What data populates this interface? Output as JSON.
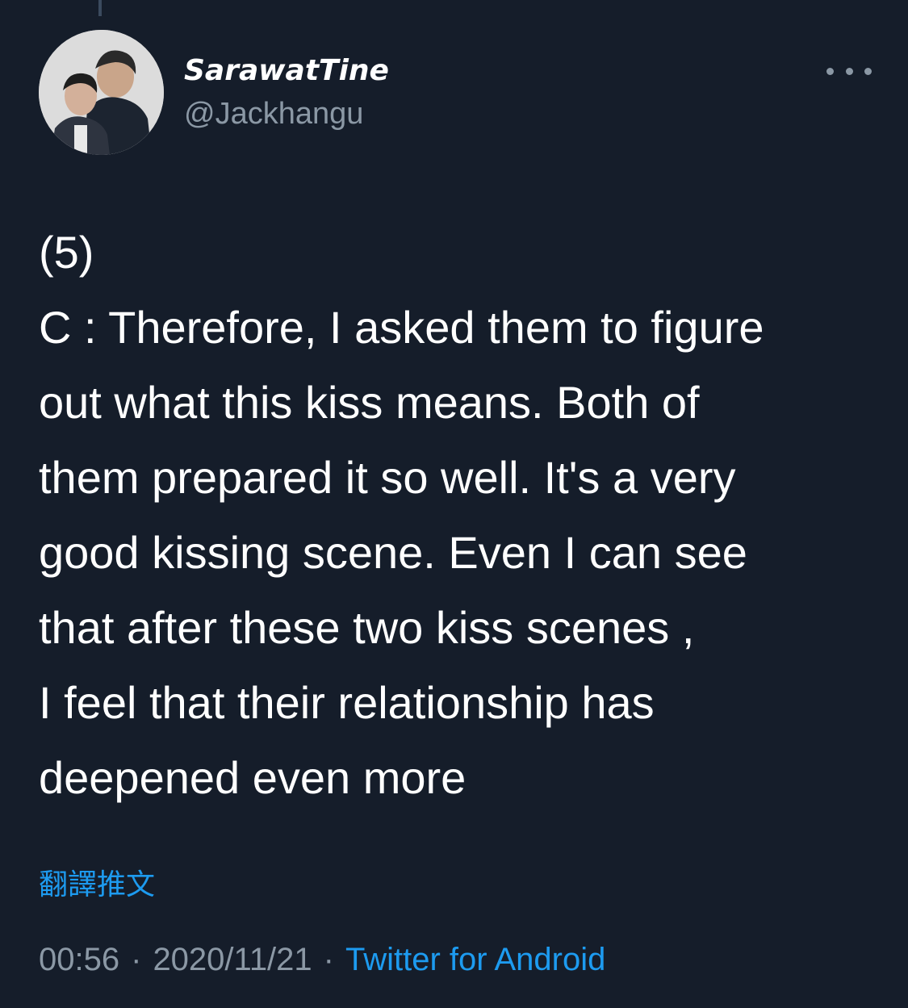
{
  "author": {
    "display_name": "SarawatTine",
    "handle": "@Jackhangu"
  },
  "tweet": {
    "lines": [
      "(5)",
      "C :  Therefore, I asked them to figure",
      "out what this kiss means. Both of",
      "them prepared it so well. It's a very",
      "good kissing scene. Even I can see",
      "that after these two kiss scenes ,",
      "I feel that their relationship has",
      "deepened even more"
    ],
    "translate_label": "翻譯推文",
    "time": "00:56",
    "separator": "·",
    "date": "2020/11/21",
    "source": "Twitter for Android"
  },
  "icons": {
    "more": "more-horizontal-icon"
  },
  "colors": {
    "background": "#151d2a",
    "text": "#ffffff",
    "muted": "#8b98a5",
    "link": "#1d9bf0"
  }
}
